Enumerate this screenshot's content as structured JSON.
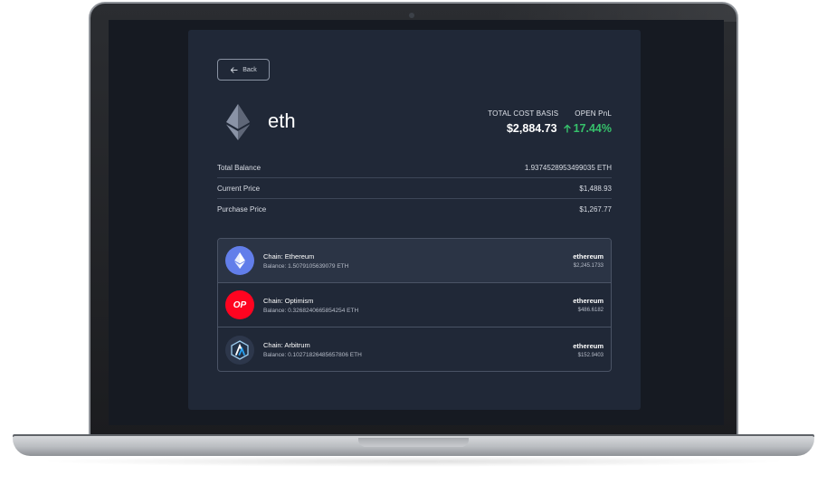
{
  "app": {
    "back_label": "Back",
    "token_name": "eth",
    "summary": {
      "cost_basis_label": "TOTAL COST BASIS",
      "open_pnl_label": "OPEN PnL",
      "cost_basis_value": "$2,884.73",
      "open_pnl_value": "17.44%"
    },
    "details": [
      {
        "label": "Total Balance",
        "value": "1.9374528953499035 ETH"
      },
      {
        "label": "Current Price",
        "value": "$1,488.93"
      },
      {
        "label": "Purchase Price",
        "value": "$1,267.77"
      }
    ],
    "chains": [
      {
        "title": "Chain: Ethereum",
        "balance": "Balance: 1.5079105639079 ETH",
        "network": "ethereum",
        "value": "$2,245.1733",
        "logo_text": ""
      },
      {
        "title": "Chain: Optimism",
        "balance": "Balance: 0.3268240665854254 ETH",
        "network": "ethereum",
        "value": "$486.6182",
        "logo_text": "OP"
      },
      {
        "title": "Chain: Arbitrum",
        "balance": "Balance: 0.10271826485657806 ETH",
        "network": "ethereum",
        "value": "$152.9403",
        "logo_text": ""
      }
    ]
  },
  "icons": {
    "back": "arrow-left-icon",
    "token": "ethereum-icon",
    "pnl": "arrow-up-icon",
    "chain_logos": [
      "ethereum-chain-icon",
      "optimism-chain-icon",
      "arbitrum-chain-icon"
    ]
  },
  "colors": {
    "panel_bg": "#202837",
    "positive": "#36c16b",
    "ethereum": "#627eea",
    "optimism": "#ff0420",
    "arbitrum": "#2d374b"
  }
}
